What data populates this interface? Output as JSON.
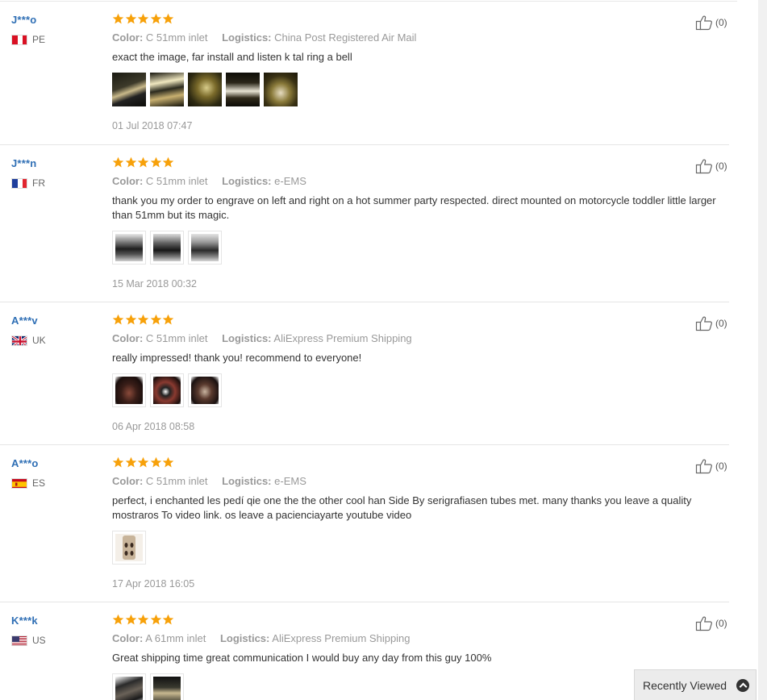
{
  "labels": {
    "color": "Color:",
    "logistics": "Logistics:"
  },
  "colors": {
    "star": "#f7a10a",
    "username": "#2f6fb5",
    "muted": "#999999"
  },
  "reviews": [
    {
      "user": "J***o",
      "country": "PE",
      "flag": "peru-flag",
      "stars": 5,
      "color_value": "C 51mm inlet",
      "logistics_value": "China Post Registered Air Mail",
      "text": "exact the image, far install and listen k tal ring a bell",
      "images": 5,
      "date": "01 Jul 2018 07:47",
      "helpful_count": "(0)"
    },
    {
      "user": "J***n",
      "country": "FR",
      "flag": "france-flag",
      "stars": 5,
      "color_value": "C 51mm inlet",
      "logistics_value": "e-EMS",
      "text": "thank you my order to engrave on left and right on a hot summer party respected. direct mounted on motorcycle toddler little larger than 51mm but its magic.",
      "images": 3,
      "date": "15 Mar 2018 00:32",
      "helpful_count": "(0)"
    },
    {
      "user": "A***v",
      "country": "UK",
      "flag": "uk-flag",
      "stars": 5,
      "color_value": "C 51mm inlet",
      "logistics_value": "AliExpress Premium Shipping",
      "text": "really impressed! thank you! recommend to everyone!",
      "images": 3,
      "date": "06 Apr 2018 08:58",
      "helpful_count": "(0)"
    },
    {
      "user": "A***o",
      "country": "ES",
      "flag": "spain-flag",
      "stars": 5,
      "color_value": "C 51mm inlet",
      "logistics_value": "e-EMS",
      "text": "perfect, i enchanted les pedí qie one the the other cool han Side By serigrafiasen tubes met. many thanks you leave a quality mostraros To video link. os leave a pacienciayarte youtube video",
      "images": 1,
      "date": "17 Apr 2018 16:05",
      "helpful_count": "(0)"
    },
    {
      "user": "K***k",
      "country": "US",
      "flag": "us-flag",
      "stars": 5,
      "color_value": "A 61mm inlet",
      "logistics_value": "AliExpress Premium Shipping",
      "text": "Great shipping time great communication I would buy any day from this guy 100%",
      "images": 2,
      "date": "",
      "helpful_count": "(0)"
    }
  ],
  "recently_viewed": {
    "label": "Recently Viewed",
    "icon": "chevron-up-circle-icon"
  }
}
